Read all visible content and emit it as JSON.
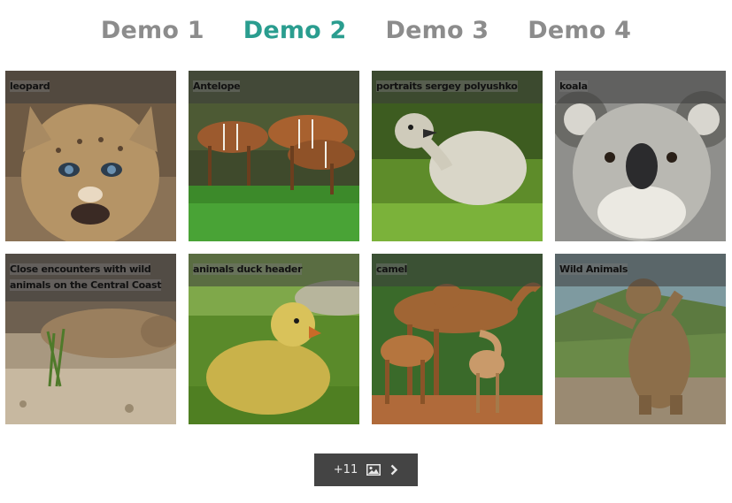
{
  "tabs": [
    {
      "label": "Demo 1",
      "active": false
    },
    {
      "label": "Demo 2",
      "active": true
    },
    {
      "label": "Demo 3",
      "active": false
    },
    {
      "label": "Demo 4",
      "active": false
    }
  ],
  "accent_color": "#2a9d8f",
  "tiles": [
    {
      "caption": "leopard",
      "subject": "cougar cub"
    },
    {
      "caption": "Antelope",
      "subject": "bongo antelopes"
    },
    {
      "caption": "portraits sergey polyushko",
      "subject": "gosling"
    },
    {
      "caption": "koala",
      "subject": "koala"
    },
    {
      "caption": "Close encounters with wild animals on the Central Coast",
      "subject": "mountain lion"
    },
    {
      "caption": "animals duck header",
      "subject": "duckling"
    },
    {
      "caption": "camel",
      "subject": "camels"
    },
    {
      "caption": "Wild Animals",
      "subject": "bear"
    }
  ],
  "more_button": {
    "label": "+11",
    "icon": "image-icon",
    "next_icon": "chevron-right-icon"
  }
}
